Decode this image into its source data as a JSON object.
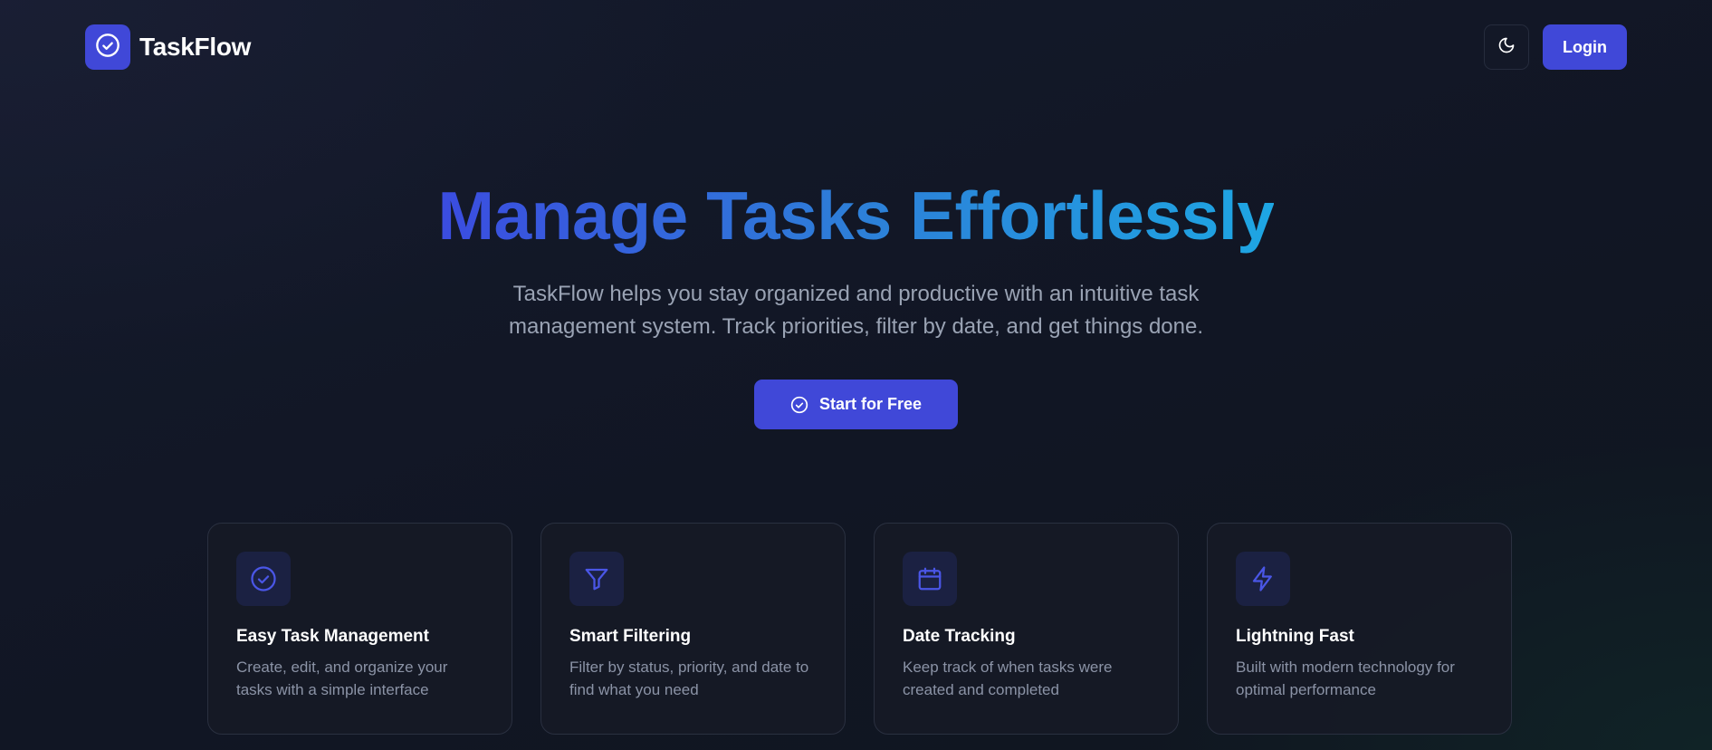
{
  "brand": {
    "name": "TaskFlow",
    "logo_icon": "check-circle-icon",
    "accent_color": "#4048d8"
  },
  "header": {
    "theme_toggle_icon": "moon-icon",
    "login_label": "Login"
  },
  "hero": {
    "title": "Manage Tasks Effortlessly",
    "title_gradient": [
      "#3b4ce0",
      "#1ea6e3"
    ],
    "subtitle": "TaskFlow helps you stay organized and productive with an intuitive task management system. Track priorities, filter by date, and get things done.",
    "cta_label": "Start for Free",
    "cta_icon": "check-circle-icon"
  },
  "features": [
    {
      "icon": "check-circle-icon",
      "title": "Easy Task Management",
      "description": "Create, edit, and organize your tasks with a simple interface"
    },
    {
      "icon": "filter-icon",
      "title": "Smart Filtering",
      "description": "Filter by status, priority, and date to find what you need"
    },
    {
      "icon": "calendar-icon",
      "title": "Date Tracking",
      "description": "Keep track of when tasks were created and completed"
    },
    {
      "icon": "lightning-icon",
      "title": "Lightning Fast",
      "description": "Built with modern technology for optimal performance"
    }
  ]
}
